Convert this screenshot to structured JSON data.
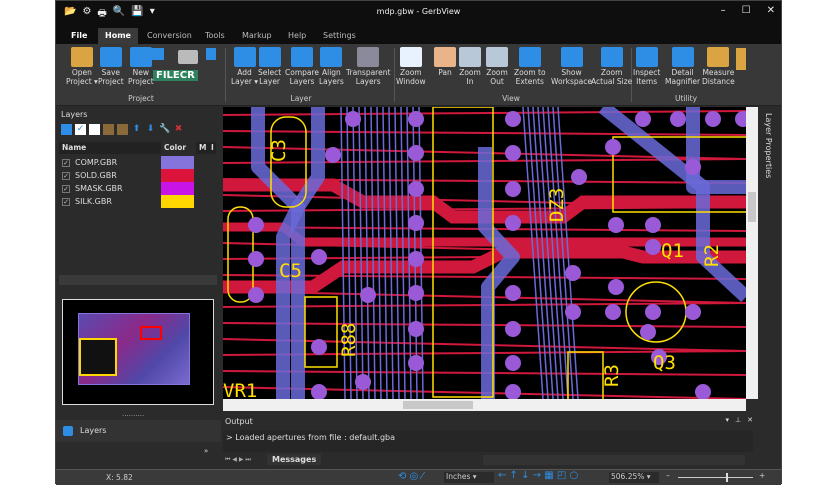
{
  "window": {
    "title": "mdp.gbw - GerbView",
    "controls": [
      "–",
      "☐",
      "✕"
    ]
  },
  "quick_access": [
    "📂",
    "⚙",
    "🖶",
    "🔍",
    "💾",
    "▾"
  ],
  "tabs": [
    {
      "label": "File"
    },
    {
      "label": "Home"
    },
    {
      "label": "Conversion"
    },
    {
      "label": "Tools"
    },
    {
      "label": "Markup"
    },
    {
      "label": "Help"
    },
    {
      "label": "Settings"
    }
  ],
  "ribbon": {
    "groups": {
      "project": "Project",
      "layer": "Layer",
      "view": "View",
      "utility": "Utility"
    },
    "buttons": [
      {
        "label": "Open\nProject ▾",
        "icon": "folder-icon",
        "color": "#d9a441"
      },
      {
        "label": "Save\nProject",
        "icon": "save-project-icon",
        "color": "#2e8ee6"
      },
      {
        "label": "New\nProject",
        "icon": "new-project-icon",
        "color": "#2e8ee6"
      },
      {
        "label": "Add\nLayer ▾",
        "icon": "add-layer-icon",
        "color": "#2e8ee6"
      },
      {
        "label": "Select\nLayer",
        "icon": "cursor-icon",
        "color": "#2e8ee6"
      },
      {
        "label": "Compare\nLayers",
        "icon": "compare-layers-icon",
        "color": "#2e8ee6"
      },
      {
        "label": "Align\nLayers",
        "icon": "align-layers-icon",
        "color": "#2e8ee6"
      },
      {
        "label": "Transparent\nLayers",
        "icon": "transparent-layers-icon",
        "color": "#8a8a9a"
      },
      {
        "label": "Zoom\nWindow",
        "icon": "zoom-window-icon",
        "color": "#e8f2ff"
      },
      {
        "label": "Pan",
        "icon": "hand-icon",
        "color": "#e9b48a"
      },
      {
        "label": "Zoom\nIn",
        "icon": "zoom-in-icon",
        "color": "#b8c8d8"
      },
      {
        "label": "Zoom\nOut",
        "icon": "zoom-out-icon",
        "color": "#b8c8d8"
      },
      {
        "label": "Zoom to\nExtents",
        "icon": "zoom-extents-icon",
        "color": "#2e8ee6"
      },
      {
        "label": "Show\nWorkspace",
        "icon": "grid-icon",
        "color": "#2e8ee6"
      },
      {
        "label": "Zoom\nActual Size",
        "icon": "actual-size-icon",
        "color": "#2e8ee6"
      },
      {
        "label": "Inspect\nItems",
        "icon": "glasses-icon",
        "color": "#2e8ee6"
      },
      {
        "label": "Detail\nMagnifier",
        "icon": "magnifier-icon",
        "color": "#2e8ee6"
      },
      {
        "label": "Measure\nDistance",
        "icon": "ruler-icon",
        "color": "#d9a441"
      }
    ],
    "watermark": "FILECR"
  },
  "layers_panel": {
    "title": "Layers",
    "columns": [
      "Name",
      "Color",
      "M",
      "I"
    ],
    "rows": [
      {
        "name": "COMP.GBR",
        "color": "#8474dc",
        "checked": true
      },
      {
        "name": "SOLD.GBR",
        "color": "#dc143c",
        "checked": true
      },
      {
        "name": "SMASK.GBR",
        "color": "#c814e6",
        "checked": true
      },
      {
        "name": "SILK.GBR",
        "color": "#ffd700",
        "checked": true
      }
    ],
    "dock_tab": "Layers"
  },
  "side_tab": "Layer Properties",
  "pcb": {
    "labels": [
      "C3",
      "C5",
      "R88",
      "VR1",
      "DZ3",
      "Q1",
      "R2",
      "R3",
      "Q3"
    ]
  },
  "output": {
    "title": "Output",
    "message": "> Loaded apertures from file : default.gba",
    "tab": "Messages"
  },
  "status": {
    "coord": "X: 5.82",
    "units": "Inches",
    "zoom": "506.25%"
  }
}
